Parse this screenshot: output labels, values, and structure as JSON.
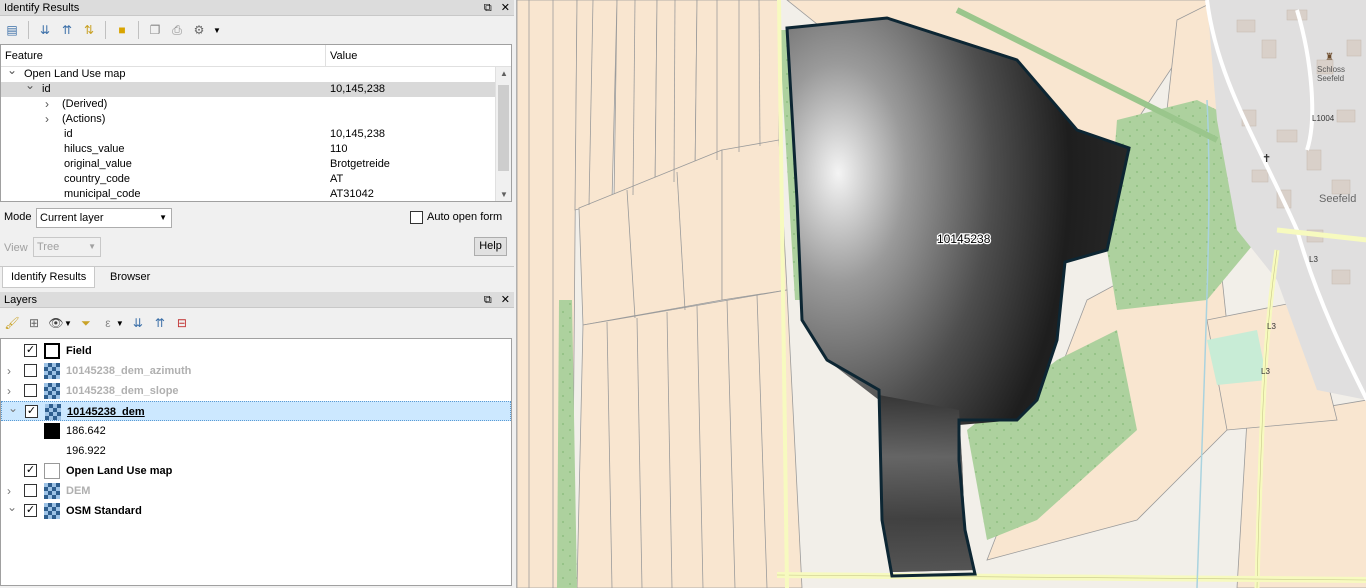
{
  "identify": {
    "title": "Identify Results",
    "columns": {
      "feature": "Feature",
      "value": "Value"
    },
    "rows": [
      {
        "key": "Open Land Use map",
        "value": "",
        "indent": 0,
        "arrow": "down"
      },
      {
        "key": "id",
        "value": "10,145,238",
        "indent": 1,
        "arrow": "down",
        "selected": true
      },
      {
        "key": "(Derived)",
        "value": "",
        "indent": 2,
        "arrow": "right"
      },
      {
        "key": "(Actions)",
        "value": "",
        "indent": 2,
        "arrow": "right"
      },
      {
        "key": "id",
        "value": "10,145,238",
        "indent": 3
      },
      {
        "key": "hilucs_value",
        "value": "110",
        "indent": 3
      },
      {
        "key": "original_value",
        "value": "Brotgetreide",
        "indent": 3
      },
      {
        "key": "country_code",
        "value": "AT",
        "indent": 3
      },
      {
        "key": "municipal_code",
        "value": "AT31042",
        "indent": 3
      }
    ],
    "mode_label": "Mode",
    "mode_value": "Current layer",
    "auto_open_label": "Auto open form",
    "view_label": "View",
    "view_value": "Tree",
    "help_label": "Help",
    "tabs": [
      "Identify Results",
      "Browser"
    ]
  },
  "layers": {
    "title": "Layers",
    "items": [
      {
        "name": "Field",
        "checked": true,
        "symbol": "polygon-outline",
        "enabled": true,
        "expander": ""
      },
      {
        "name": "10145238_dem_azimuth",
        "checked": false,
        "symbol": "raster",
        "enabled": false,
        "expander": "right"
      },
      {
        "name": "10145238_dem_slope",
        "checked": false,
        "symbol": "raster",
        "enabled": false,
        "expander": "right"
      },
      {
        "name": "10145238_dem",
        "checked": true,
        "symbol": "raster",
        "enabled": true,
        "expander": "down",
        "selected": true
      },
      {
        "name": "Open Land Use map",
        "checked": true,
        "symbol": "polygon-white",
        "enabled": true,
        "expander": ""
      },
      {
        "name": "DEM",
        "checked": false,
        "symbol": "raster",
        "enabled": false,
        "expander": "right"
      },
      {
        "name": "OSM Standard",
        "checked": true,
        "symbol": "raster",
        "enabled": true,
        "expander": "down"
      }
    ],
    "legend": [
      {
        "label": "186.642",
        "color": "#000000"
      },
      {
        "label": "196.922",
        "color": "#ffffff"
      }
    ]
  },
  "map": {
    "field_label": "10145238",
    "place_labels": [
      "Schloss",
      "Seefeld",
      "Seefeld",
      "L1004",
      "L3",
      "L3",
      "L3"
    ],
    "colors": {
      "farmland": "#f9e6d0",
      "forest": "#add19e",
      "residential": "#e0dfdf",
      "road": "#f7fabf",
      "outline": "#0d2633"
    }
  }
}
